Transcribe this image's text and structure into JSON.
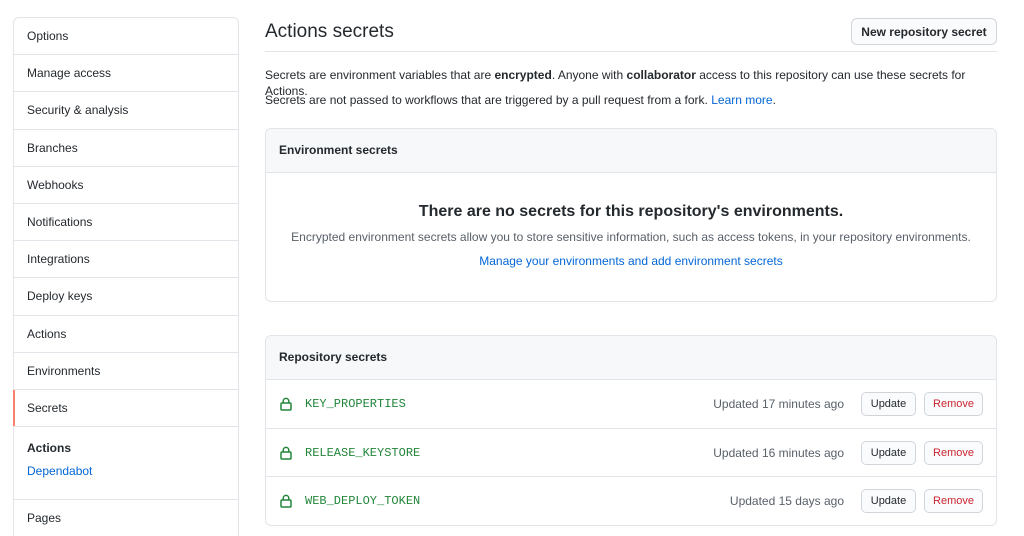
{
  "sidebar": {
    "items": [
      {
        "label": "Options"
      },
      {
        "label": "Manage access"
      },
      {
        "label": "Security & analysis"
      },
      {
        "label": "Branches"
      },
      {
        "label": "Webhooks"
      },
      {
        "label": "Notifications"
      },
      {
        "label": "Integrations"
      },
      {
        "label": "Deploy keys"
      },
      {
        "label": "Actions"
      },
      {
        "label": "Environments"
      },
      {
        "label": "Secrets",
        "selected": true
      }
    ],
    "group": {
      "title": "Actions",
      "link": "Dependabot"
    },
    "after": [
      {
        "label": "Pages"
      }
    ]
  },
  "header": {
    "title": "Actions secrets",
    "new_button": "New repository secret"
  },
  "description": {
    "line1_a": "Secrets are environment variables that are ",
    "line1_b": "encrypted",
    "line1_c": ". Anyone with ",
    "line1_d": "collaborator",
    "line1_e": " access to this repository can use these secrets for Actions.",
    "line2_a": "Secrets are not passed to workflows that are triggered by a pull request from a fork. ",
    "line2_link": "Learn more",
    "line2_b": "."
  },
  "environment": {
    "header": "Environment secrets",
    "blank_title": "There are no secrets for this repository's environments.",
    "blank_text": "Encrypted environment secrets allow you to store sensitive information, such as access tokens, in your repository environments.",
    "blank_link": "Manage your environments and add environment secrets"
  },
  "repository": {
    "header": "Repository secrets",
    "update_label": "Update",
    "remove_label": "Remove",
    "secrets": [
      {
        "name": "KEY_PROPERTIES",
        "updated": "Updated 17 minutes ago"
      },
      {
        "name": "RELEASE_KEYSTORE",
        "updated": "Updated 16 minutes ago"
      },
      {
        "name": "WEB_DEPLOY_TOKEN",
        "updated": "Updated 15 days ago"
      }
    ]
  },
  "colors": {
    "accent": "#0366d6",
    "secret_green": "#22863a",
    "danger": "#cb2431",
    "selected_bar": "#f9826c"
  }
}
